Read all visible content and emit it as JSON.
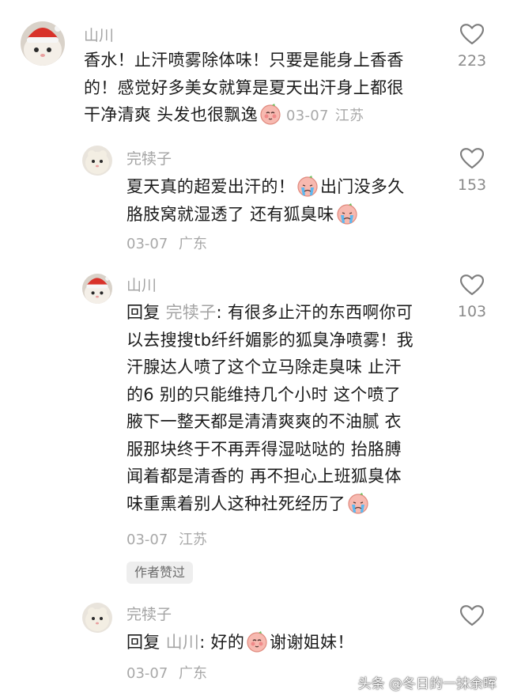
{
  "comments": [
    {
      "username": "山川",
      "lines": [
        "香水！止汗喷雾除体味！只要是能身上香香",
        "的！感觉好多美女就算是夏天出汗身上都很",
        "干净清爽 头发也很飘逸"
      ],
      "emoji": "blush-face-emoji",
      "date": "03-07",
      "location": "江苏",
      "likes": "223"
    },
    {
      "username": "完犊子",
      "lines": [
        "夏天真的超爱出汗的！",
        "出门没多久",
        "胳肢窝就湿透了 还有狐臭味"
      ],
      "emoji": "crying-face-emoji",
      "date": "03-07",
      "location": "广东",
      "likes": "153"
    },
    {
      "username": "山川",
      "reply_prefix": "回复",
      "reply_target": "完犊子",
      "lines": [
        ": 有很多止汗的东西啊你可",
        "以去搜搜tb纤纤媚影的狐臭净喷雾！我",
        "汗腺达人喷了这个立马除走臭味 止汗",
        "的6 别的只能维持几个小时 这个喷了",
        "腋下一整天都是清清爽爽的不油腻 衣",
        "服那块终于不再弄得湿哒哒的 抬胳膊",
        "闻着都是清香的 再不担心上班狐臭体",
        "味重熏着别人这种社死经历了"
      ],
      "emoji": "crying-face-emoji",
      "date": "03-07",
      "location": "江苏",
      "likes": "103",
      "badge": "作者赞过"
    },
    {
      "username": "完犊子",
      "reply_prefix": "回复",
      "reply_target": "山川",
      "lines": [
        ": 好的",
        "谢谢姐妹！"
      ],
      "emoji": "blush-face-emoji",
      "date": "03-07",
      "location": "广东",
      "likes": ""
    }
  ],
  "watermark": "头条 @冬日的一抹余晖",
  "colors": {
    "text": "#1b1b1b",
    "muted": "#a4a4a4",
    "badge_bg": "#eeeeee"
  }
}
